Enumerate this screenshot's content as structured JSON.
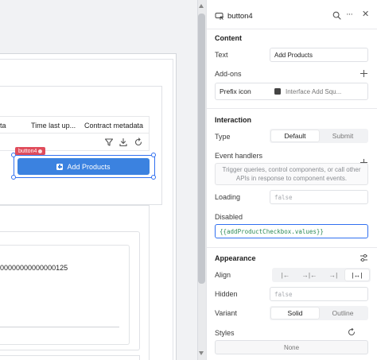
{
  "canvas": {
    "table": {
      "columns": [
        "ta",
        "Time last up...",
        "Contract metadata"
      ]
    },
    "component_tag": "button4",
    "button_label": "Add Products",
    "metadata_value": "00000000000000125"
  },
  "inspector": {
    "component_name": "button4",
    "content": {
      "title": "Content",
      "text_label": "Text",
      "text_value": "Add Products",
      "addons_label": "Add-ons",
      "prefix_icon_label": "Prefix icon",
      "prefix_icon_value": "Interface Add Squ..."
    },
    "interaction": {
      "title": "Interaction",
      "type_label": "Type",
      "type_options": [
        "Default",
        "Submit"
      ],
      "type_selected": "Default",
      "event_handlers_label": "Event handlers",
      "event_handlers_hint": "Trigger queries, control components, or call other APIs in response to component events.",
      "loading_label": "Loading",
      "loading_placeholder": "false",
      "disabled_label": "Disabled",
      "disabled_value": "{{addProductCheckbox.values}}"
    },
    "appearance": {
      "title": "Appearance",
      "align_label": "Align",
      "hidden_label": "Hidden",
      "hidden_placeholder": "false",
      "variant_label": "Variant",
      "variant_options": [
        "Solid",
        "Outline"
      ],
      "variant_selected": "Solid",
      "styles_label": "Styles",
      "styles_value": "None"
    }
  },
  "colors": {
    "accent": "#3b82e0",
    "selection": "#3170f0",
    "tag": "#e04c5b",
    "code": "#2e8b57"
  }
}
